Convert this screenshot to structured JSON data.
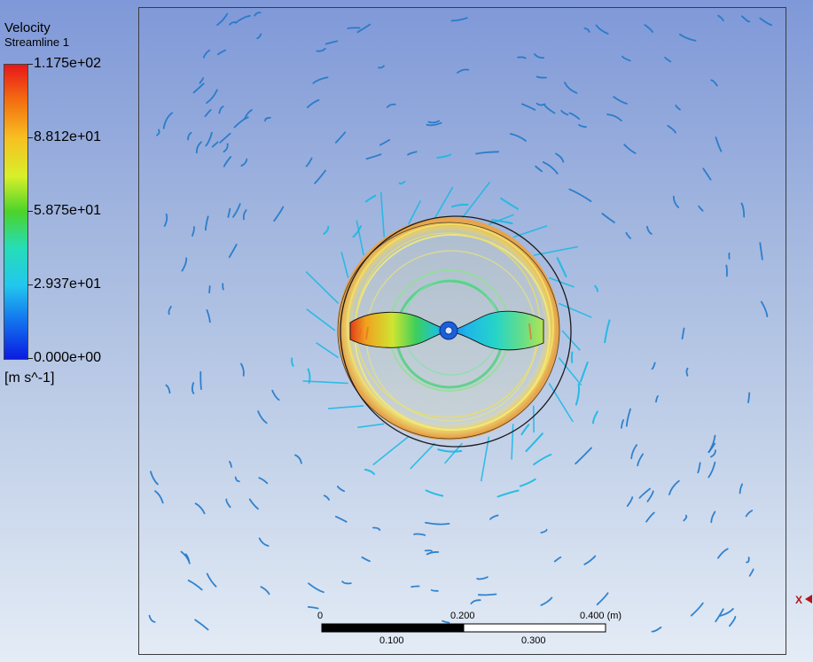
{
  "legend": {
    "title": "Velocity",
    "subtitle": "Streamline 1",
    "ticks": [
      "1.175e+02",
      "8.812e+01",
      "5.875e+01",
      "2.937e+01",
      "0.000e+00"
    ],
    "unit": "[m s^-1]"
  },
  "scale_bar": {
    "top_labels": [
      "0",
      "0.200",
      "0.400 (m)"
    ],
    "bottom_labels": [
      "0.100",
      "0.300"
    ]
  },
  "axis": {
    "label": "X"
  },
  "colors": {
    "streamline_far": "#1f78c9",
    "streamline_mid": "#16b9e4",
    "ring": "#ead254",
    "blade_tip": "#e53b1a",
    "hub": "#1b60d8",
    "scale_bar": "#000000"
  }
}
